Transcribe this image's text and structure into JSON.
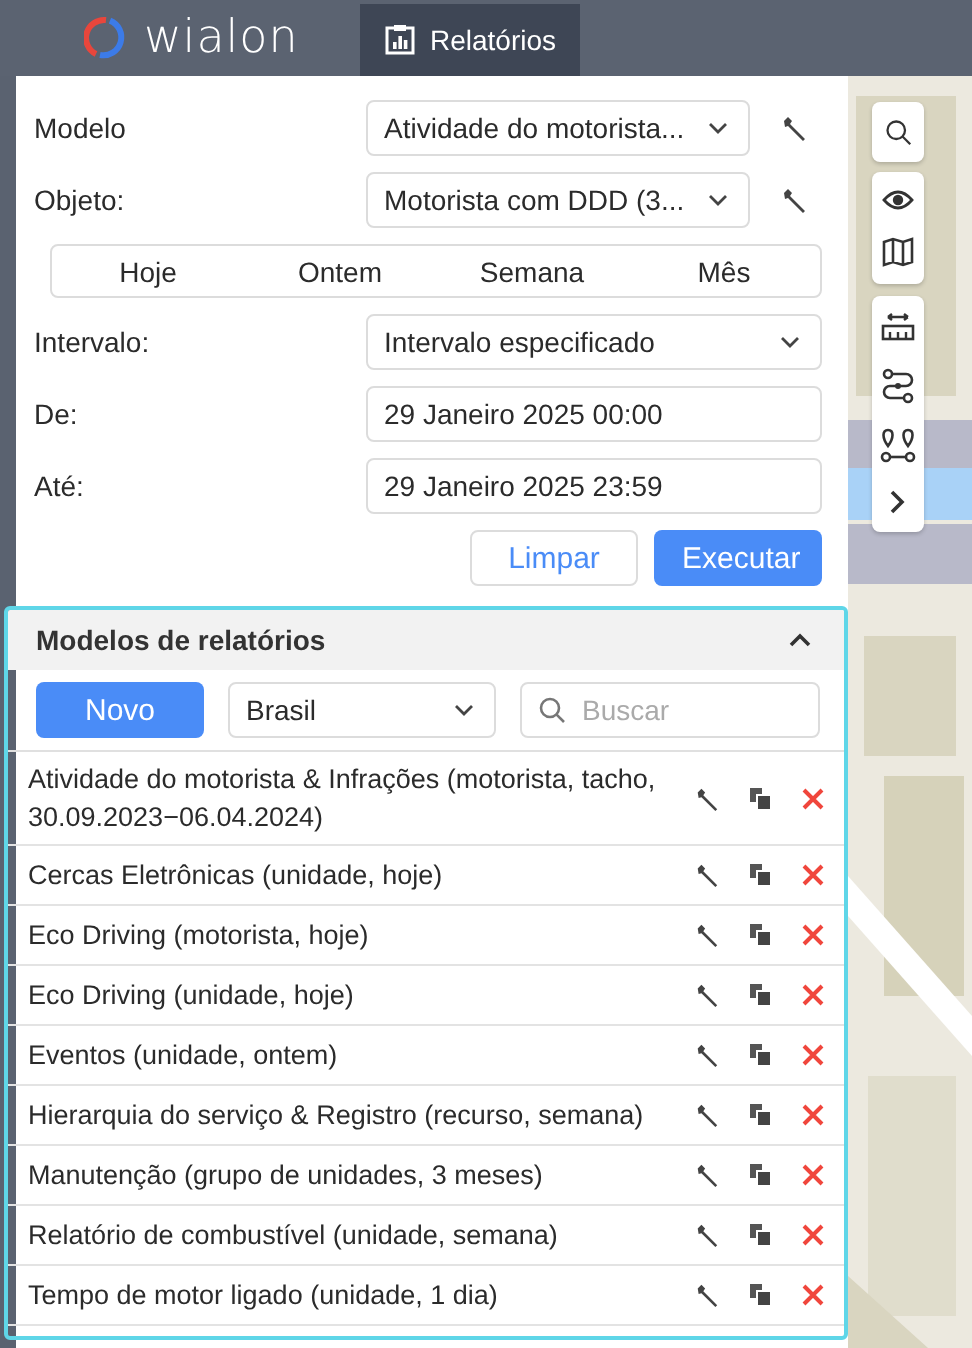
{
  "header": {
    "logo": "wialon",
    "tabs": [
      {
        "label": "Relatórios",
        "selected": true
      }
    ]
  },
  "form": {
    "template": {
      "label": "Modelo",
      "value": "Atividade do motorista..."
    },
    "object": {
      "label": "Objeto:",
      "value": "Motorista com DDD (3..."
    },
    "periods": [
      {
        "label": "Hoje"
      },
      {
        "label": "Ontem"
      },
      {
        "label": "Semana"
      },
      {
        "label": "Mês"
      }
    ],
    "interval": {
      "label": "Intervalo:",
      "value": "Intervalo especificado"
    },
    "from": {
      "label": "De:",
      "value": "29 Janeiro 2025 00:00"
    },
    "to": {
      "label": "Até:",
      "value": "29 Janeiro 2025 23:59"
    },
    "buttons": [
      {
        "label": "Limpar",
        "kind": "secondary"
      },
      {
        "label": "Executar",
        "kind": "primary"
      }
    ]
  },
  "templates": {
    "title": "Modelos de relatórios",
    "expanded": true,
    "new_button": "Novo",
    "filter": "Brasil",
    "search": {
      "placeholder": "Buscar"
    },
    "rows": [
      {
        "name": "Atividade do motorista & Infrações (motorista, tacho, 30.09.2023−06.04.2024)"
      },
      {
        "name": "Cercas Eletrônicas (unidade, hoje)"
      },
      {
        "name": "Eco Driving (motorista, hoje)"
      },
      {
        "name": "Eco Driving (unidade, hoje)"
      },
      {
        "name": "Eventos (unidade, ontem)"
      },
      {
        "name": "Hierarquia do serviço & Registro (recurso, semana)"
      },
      {
        "name": "Manutenção (grupo de unidades, 3 meses)"
      },
      {
        "name": "Relatório de combustível (unidade, semana)"
      },
      {
        "name": "Tempo de motor ligado (unidade, 1 dia)"
      }
    ]
  }
}
